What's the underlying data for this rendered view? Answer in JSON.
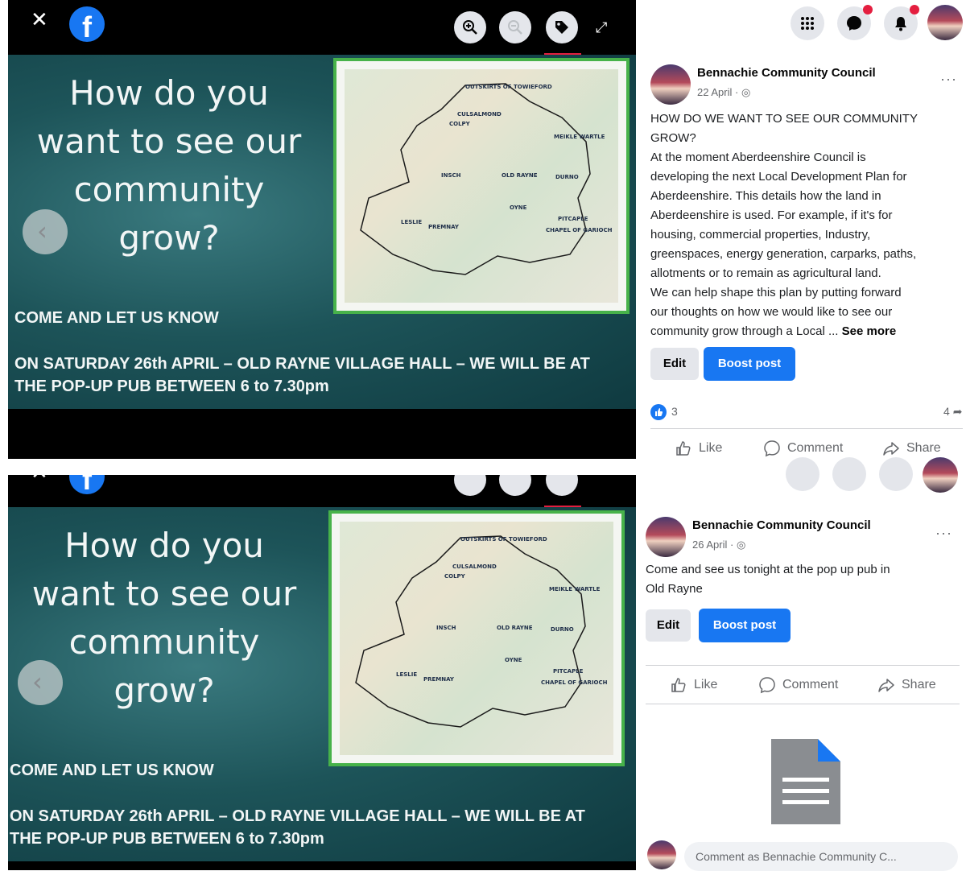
{
  "slide": {
    "title_lines": [
      "How do you",
      "want to see our",
      "community",
      "grow?"
    ],
    "cta": "COME AND LET US KNOW",
    "event_line1": "ON  SATURDAY 26th APRIL – OLD RAYNE VILLAGE HALL – WE WILL BE AT",
    "event_line2": "THE POP-UP PUB BETWEEN 6 to 7.30pm",
    "map_labels": [
      "OUTSKIRTS OF TOWIEFORD",
      "CULSALMOND",
      "COLPY",
      "MEIKLE WARTLE",
      "INSCH",
      "OLD RAYNE",
      "DURNO",
      "OYNE",
      "LESLIE",
      "PREMNAY",
      "CHAPEL OF GARIOCH",
      "PITCAPLE"
    ]
  },
  "viewer": {
    "close_icon": "close-icon",
    "logo": "f",
    "prev_glyph": "‹",
    "expand_glyph": "⤢"
  },
  "post1": {
    "author": "Bennachie Community Council",
    "date": "22 April ·",
    "more": "···",
    "heading": "HOW DO WE WANT TO SEE OUR COMMUNITY GROW?",
    "body_lines": [
      "At the moment Aberdeenshire Council is",
      "developing the next Local Development Plan for",
      "Aberdeenshire. This details how the land in",
      "Aberdeenshire is used. For example, if it's for",
      "housing, commercial properties, Industry,",
      "greenspaces, energy generation, carparks, paths,",
      "allotments or to remain as agricultural land.",
      "We can help shape this plan by putting forward",
      "our thoughts on how we would like to see our",
      "community grow through a Local ... "
    ],
    "see_more": "See more",
    "edit_label": "Edit",
    "boost_label": "Boost post",
    "reactions": "3",
    "shares": "4",
    "like_label": "Like",
    "comment_label": "Comment",
    "share_label": "Share"
  },
  "post2": {
    "author": "Bennachie Community Council",
    "date": "26 April ·",
    "more": "···",
    "body_lines": [
      "Come and see us tonight at the pop up pub in",
      "Old Rayne"
    ],
    "edit_label": "Edit",
    "boost_label": "Boost post",
    "like_label": "Like",
    "comment_label": "Comment",
    "share_label": "Share",
    "comment_placeholder": "Comment as Bennachie Community C..."
  },
  "colors": {
    "accent": "#1877f2",
    "slide_bg": "#1d5459",
    "map_border": "#47b24a",
    "badge": "#e41e3f"
  }
}
